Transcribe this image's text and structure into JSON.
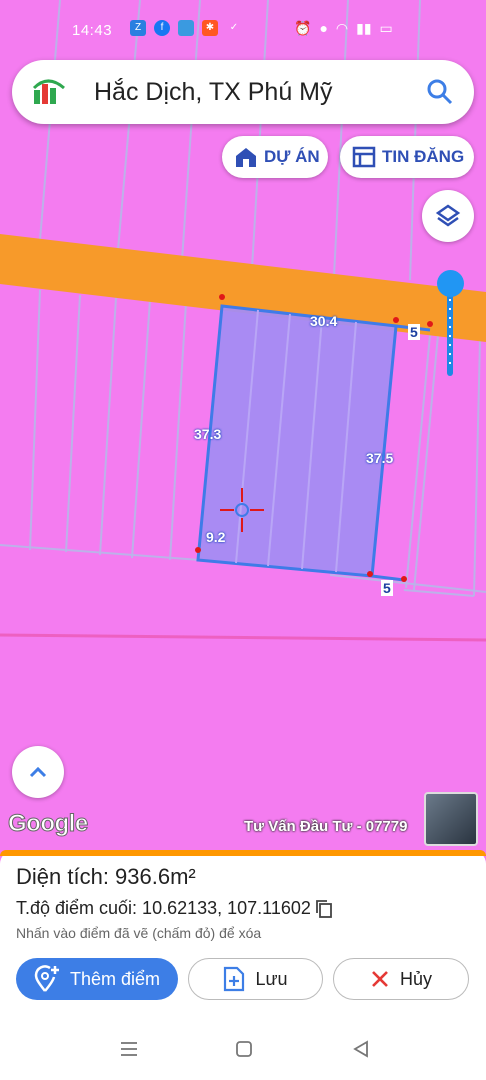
{
  "status_bar": {
    "time": "14:43"
  },
  "search": {
    "title": "Hắc Dịch, TX Phú Mỹ"
  },
  "chips": {
    "du_an": "DỰ ÁN",
    "tin_dang": "TIN ĐĂNG"
  },
  "map": {
    "edge_labels": [
      "30.4",
      "5",
      "37.3",
      "37.5",
      "5",
      "9.2"
    ],
    "provider": "Google",
    "watermark": "Tư Vấn Đầu Tư - 07779"
  },
  "panel": {
    "area_text": "Diện tích: 936.6m²",
    "coords_text": "T.độ điểm cuối: 10.62133, 107.11602",
    "hint": "Nhấn vào điểm đã vẽ (chấm đỏ) để xóa",
    "add_point_label": "Thêm điểm",
    "save_label": "Lưu",
    "cancel_label": "Hủy"
  },
  "colors": {
    "zone": "#f47cf0",
    "road": "#f79a2a",
    "parcel": "#a48cf2",
    "accent": "#3d7ee6"
  }
}
